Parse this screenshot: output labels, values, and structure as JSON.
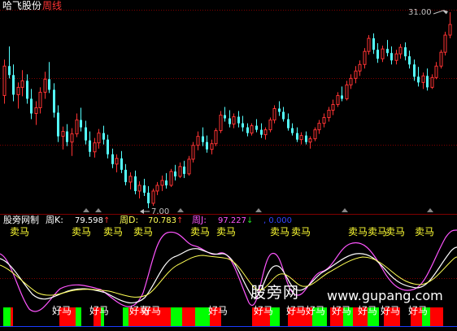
{
  "header": {
    "stock_name": "哈飞股份",
    "period": "周线"
  },
  "price_panel": {
    "high_label": "31.00",
    "low_label": "7.00",
    "colors": {
      "up": "#ff3333",
      "down": "#54ffff",
      "grid": "#800000"
    },
    "candles": [
      [
        20.8,
        25.2,
        19.8,
        24.4
      ],
      [
        24.4,
        26.8,
        22.9,
        23.3
      ],
      [
        23.3,
        24.6,
        20.1,
        20.9
      ],
      [
        20.9,
        22.4,
        19.2,
        21.8
      ],
      [
        21.8,
        23.9,
        20.7,
        22.6
      ],
      [
        22.6,
        23.4,
        19.8,
        20.4
      ],
      [
        20.4,
        21.6,
        17.9,
        18.6
      ],
      [
        18.6,
        20.1,
        17.2,
        19.3
      ],
      [
        19.3,
        21.8,
        18.6,
        21.2
      ],
      [
        21.2,
        23.7,
        20.4,
        22.8
      ],
      [
        22.8,
        24.9,
        21.1,
        21.5
      ],
      [
        21.5,
        22.3,
        18.1,
        18.7
      ],
      [
        18.7,
        19.6,
        15.1,
        15.8
      ],
      [
        15.8,
        17.0,
        14.2,
        16.4
      ],
      [
        16.4,
        17.3,
        14.6,
        15.1
      ],
      [
        15.1,
        16.8,
        13.4,
        16.1
      ],
      [
        16.1,
        18.6,
        15.7,
        17.8
      ],
      [
        17.8,
        19.3,
        16.4,
        16.9
      ],
      [
        16.9,
        17.7,
        14.8,
        15.3
      ],
      [
        15.3,
        16.4,
        13.3,
        13.9
      ],
      [
        13.9,
        15.6,
        13.2,
        15.0
      ],
      [
        15.0,
        16.7,
        14.3,
        16.2
      ],
      [
        16.2,
        17.1,
        14.8,
        15.4
      ],
      [
        15.4,
        16.0,
        13.1,
        13.6
      ],
      [
        13.6,
        14.3,
        11.9,
        12.4
      ],
      [
        12.4,
        13.6,
        11.4,
        13.1
      ],
      [
        13.1,
        14.0,
        11.3,
        11.7
      ],
      [
        11.7,
        12.4,
        9.8,
        10.2
      ],
      [
        10.2,
        11.4,
        9.3,
        10.9
      ],
      [
        10.9,
        11.6,
        8.7,
        9.1
      ],
      [
        9.1,
        10.3,
        8.2,
        9.8
      ],
      [
        9.8,
        10.6,
        8.5,
        8.9
      ],
      [
        8.9,
        9.7,
        7.0,
        7.6
      ],
      [
        7.6,
        9.4,
        7.3,
        9.1
      ],
      [
        9.1,
        10.2,
        8.6,
        9.8
      ],
      [
        9.8,
        11.0,
        9.1,
        10.4
      ],
      [
        10.4,
        11.3,
        9.4,
        9.8
      ],
      [
        9.8,
        11.8,
        9.6,
        11.5
      ],
      [
        11.5,
        12.3,
        10.4,
        10.9
      ],
      [
        10.9,
        12.6,
        10.7,
        12.1
      ],
      [
        12.1,
        12.8,
        10.7,
        11.2
      ],
      [
        11.2,
        13.4,
        11.0,
        13.0
      ],
      [
        13.0,
        15.1,
        12.6,
        14.7
      ],
      [
        14.7,
        16.4,
        14.1,
        15.8
      ],
      [
        15.8,
        16.9,
        14.6,
        15.1
      ],
      [
        15.1,
        15.9,
        13.8,
        14.2
      ],
      [
        14.2,
        15.4,
        13.6,
        14.9
      ],
      [
        14.9,
        16.8,
        14.6,
        16.5
      ],
      [
        16.5,
        18.9,
        16.2,
        18.4
      ],
      [
        18.4,
        19.4,
        17.6,
        18.0
      ],
      [
        18.0,
        19.0,
        16.9,
        17.3
      ],
      [
        17.3,
        18.6,
        16.8,
        18.2
      ],
      [
        18.2,
        18.9,
        16.9,
        17.4
      ],
      [
        17.4,
        18.3,
        16.4,
        16.9
      ],
      [
        16.9,
        17.4,
        15.8,
        16.2
      ],
      [
        16.2,
        17.4,
        15.9,
        17.1
      ],
      [
        17.1,
        17.9,
        16.3,
        16.6
      ],
      [
        16.6,
        17.4,
        15.6,
        16.0
      ],
      [
        16.0,
        16.9,
        15.4,
        16.6
      ],
      [
        16.6,
        18.1,
        16.3,
        17.8
      ],
      [
        17.8,
        19.6,
        17.4,
        19.2
      ],
      [
        19.2,
        20.1,
        18.3,
        18.8
      ],
      [
        18.8,
        19.4,
        17.6,
        17.9
      ],
      [
        17.9,
        18.6,
        16.5,
        16.8
      ],
      [
        16.8,
        17.4,
        15.9,
        16.2
      ],
      [
        16.2,
        16.9,
        15.1,
        15.4
      ],
      [
        15.4,
        16.3,
        14.8,
        15.9
      ],
      [
        15.9,
        16.4,
        14.8,
        15.1
      ],
      [
        15.1,
        15.8,
        14.3,
        15.5
      ],
      [
        15.5,
        16.9,
        15.2,
        16.6
      ],
      [
        16.6,
        17.8,
        16.1,
        17.4
      ],
      [
        17.4,
        18.6,
        16.9,
        18.1
      ],
      [
        18.1,
        19.4,
        17.6,
        19.0
      ],
      [
        19.0,
        20.3,
        18.4,
        19.7
      ],
      [
        19.7,
        21.2,
        19.4,
        20.8
      ],
      [
        20.8,
        21.9,
        20.1,
        20.4
      ],
      [
        20.4,
        22.6,
        20.2,
        22.1
      ],
      [
        22.1,
        23.4,
        21.6,
        22.9
      ],
      [
        22.9,
        24.4,
        22.3,
        23.8
      ],
      [
        23.8,
        25.1,
        23.2,
        24.6
      ],
      [
        24.6,
        26.6,
        24.1,
        26.2
      ],
      [
        26.2,
        28.2,
        25.8,
        27.8
      ],
      [
        27.8,
        28.4,
        25.9,
        26.4
      ],
      [
        26.4,
        27.2,
        24.8,
        25.3
      ],
      [
        25.3,
        26.9,
        24.9,
        26.5
      ],
      [
        26.5,
        27.6,
        25.6,
        26.0
      ],
      [
        26.0,
        26.8,
        24.6,
        25.1
      ],
      [
        25.1,
        26.4,
        24.6,
        25.9
      ],
      [
        25.9,
        27.1,
        25.3,
        26.7
      ],
      [
        26.7,
        27.3,
        25.1,
        25.6
      ],
      [
        25.6,
        26.3,
        24.1,
        24.6
      ],
      [
        24.6,
        25.2,
        22.6,
        23.1
      ],
      [
        23.1,
        24.3,
        21.9,
        22.4
      ],
      [
        22.4,
        23.6,
        21.6,
        23.2
      ],
      [
        23.2,
        24.1,
        21.4,
        21.8
      ],
      [
        21.8,
        23.4,
        21.6,
        23.0
      ],
      [
        23.0,
        24.9,
        22.8,
        24.4
      ],
      [
        24.4,
        26.4,
        24.1,
        26.1
      ],
      [
        26.1,
        28.6,
        25.7,
        28.2
      ],
      [
        28.2,
        31.0,
        27.8,
        29.5
      ]
    ]
  },
  "indicator_panel": {
    "name": "股旁网制",
    "k_label": "周K",
    "k_value": "79.598",
    "k_arrow": "↑",
    "d_label": "周D",
    "d_value": "70.783",
    "d_arrow": "↑",
    "j_label": "周J",
    "j_value": "97.227",
    "j_arrow": "↓",
    "z_value": "0.000",
    "colors": {
      "k": "#ffffff",
      "d": "#ffff55",
      "j": "#ff55ff",
      "z": "#3344ff"
    },
    "sell_text": "卖马",
    "buy_text": "好马",
    "sell_labels": [
      "卖马",
      "卖马",
      "卖马",
      "卖马",
      "卖马",
      "卖马",
      "卖马",
      "卖马",
      "卖马",
      "卖马",
      "卖马",
      "卖马"
    ],
    "buy_labels": [
      "好马",
      "好马",
      "好马",
      "好马",
      "好马",
      "好马",
      "好马",
      "好马",
      "好马",
      "好马",
      "好马",
      "好马"
    ]
  },
  "watermark": {
    "text": "股旁网",
    "url": "www.gupang.com"
  }
}
